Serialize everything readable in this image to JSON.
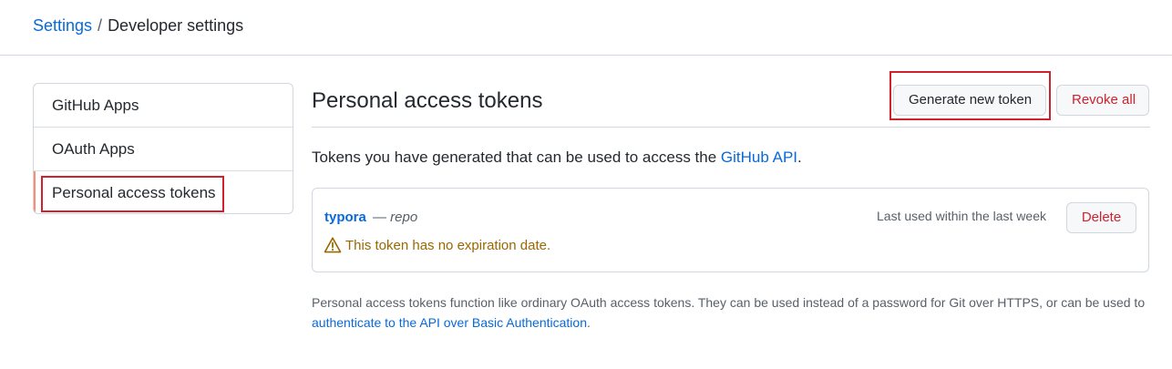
{
  "breadcrumb": {
    "parent": "Settings",
    "separator": "/",
    "current": "Developer settings"
  },
  "sidebar": {
    "items": [
      {
        "label": "GitHub Apps"
      },
      {
        "label": "OAuth Apps"
      },
      {
        "label": "Personal access tokens",
        "active": true
      }
    ]
  },
  "main": {
    "title": "Personal access tokens",
    "generate_label": "Generate new token",
    "revoke_label": "Revoke all",
    "description_prefix": "Tokens you have generated that can be used to access the ",
    "description_link": "GitHub API",
    "description_suffix": ".",
    "token": {
      "name": "typora",
      "dash": " — ",
      "scope": "repo",
      "last_used": "Last used within the last week",
      "delete_label": "Delete",
      "warning": "This token has no expiration date."
    },
    "footnote_prefix": "Personal access tokens function like ordinary OAuth access tokens. They can be used instead of a password for Git over HTTPS, or can be used to ",
    "footnote_link": "authenticate to the API over Basic Authentication",
    "footnote_suffix": "."
  },
  "colors": {
    "link": "#0969da",
    "danger": "#cf222e",
    "warning": "#9a6700",
    "active_indicator": "#fd8c73"
  },
  "icons": {
    "warning": "alert-triangle-icon"
  }
}
